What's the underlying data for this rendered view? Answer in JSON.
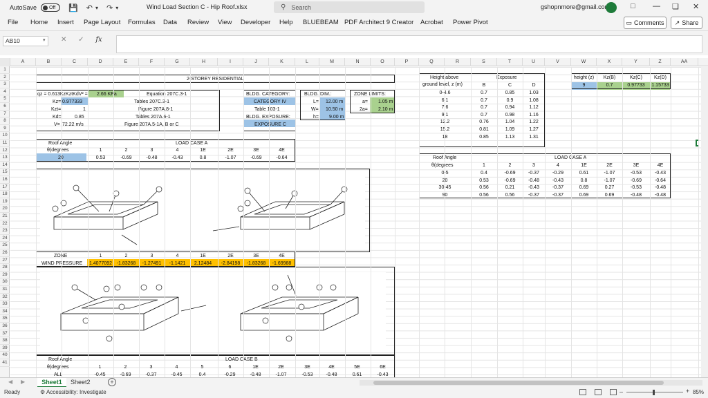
{
  "titlebar": {
    "autosave_label": "AutoSave",
    "autosave_state": "Off",
    "title": "Wind Load Section C - Hip Roof.xlsx",
    "search_placeholder": "Search",
    "user": "gshopnmore@gmail.com"
  },
  "menu": [
    "File",
    "Home",
    "Insert",
    "Page Layout",
    "Formulas",
    "Data",
    "Review",
    "View",
    "Developer",
    "Help",
    "BLUEBEAM",
    "PDF Architect 9 Creator",
    "Acrobat",
    "Power Pivot"
  ],
  "buttons": {
    "comments": "Comments",
    "share": "Share"
  },
  "formula_bar": {
    "name_box": "AB10",
    "fx": "fx"
  },
  "columns": [
    "A",
    "B",
    "C",
    "D",
    "E",
    "F",
    "G",
    "H",
    "I",
    "J",
    "K",
    "L",
    "M",
    "N",
    "O",
    "P",
    "Q",
    "R",
    "S",
    "T",
    "U",
    "V",
    "W",
    "X",
    "Y",
    "Z",
    "AA"
  ],
  "rows": [
    "1",
    "2",
    "3",
    "4",
    "5",
    "6",
    "7",
    "8",
    "9",
    "10",
    "11",
    "12",
    "13",
    "14",
    "15",
    "16",
    "17",
    "18",
    "19",
    "20",
    "21",
    "22",
    "23",
    "24",
    "25",
    "26",
    "27",
    "28",
    "29",
    "30",
    "31",
    "32",
    "33",
    "34",
    "35",
    "36",
    "37",
    "38",
    "39",
    "40",
    "41"
  ],
  "main": {
    "title": "2-STOREY RESIDENTIAL",
    "qz_label": "qz = 0.613KzKztKdV² =",
    "qz_value": "2.66 KPa",
    "qz_ref": "Equation 207C.3-1",
    "kz_label": "Kz=",
    "kz_value": "0.977333",
    "kz_ref": "Tables 207C.3-1",
    "kzt_label": "Kzt=",
    "kzt_value": "1",
    "kzt_ref": "Figure 207A.8-1",
    "kd_label": "Kd=",
    "kd_value": "0.85",
    "kd_ref": "Tables 207A.6-1",
    "v_label": "V=",
    "v_value": "72.22 m/s",
    "v_ref": "Figure 207A.5-1A, B or C",
    "bldg_category_label": "BLDG. CATEGORY:",
    "bldg_category_value": "CATEGORY IV",
    "table_ref": "Table 103-1",
    "bldg_exposure_label": "BLDG. EXPOSURE:",
    "bldg_exposure_value": "EXPOSURE C",
    "bldg_dim_label": "BLDG. DIM.:",
    "L_label": "L=",
    "L_value": "12.00 m",
    "W_label": "W=",
    "W_value": "10.50 m",
    "h_label": "h=",
    "h_value": "9.00 m",
    "zone_limits_label": "ZONE LIMITS:",
    "a_label": "a=",
    "a_value": "1.05 m",
    "a2_label": "2a=",
    "a2_value": "2.10 m"
  },
  "load_case_a_main": {
    "roof_angle_label": "Roof Angle",
    "theta_label": "θ(degrees",
    "title": "LOAD CASE A",
    "headers": [
      "1",
      "2",
      "3",
      "4",
      "1E",
      "2E",
      "3E",
      "4E"
    ],
    "angle": "20",
    "values": [
      "0.53",
      "-0.69",
      "-0.48",
      "-0.43",
      "0.8",
      "-1.07",
      "-0.69",
      "-0.64"
    ]
  },
  "wind_pressure": {
    "zone_label": "ZONE",
    "label": "WIND PRESSURE",
    "headers": [
      "1",
      "2",
      "3",
      "4",
      "1E",
      "2E",
      "3E",
      "4E"
    ],
    "values": [
      "1.4077092",
      "-1.83268",
      "-1.27491",
      "-1.1421",
      "2.12484",
      "-2.84198",
      "-1.83268",
      "-1.69988"
    ]
  },
  "load_case_b": {
    "roof_angle_label": "Roof Angle",
    "theta_label": "θ(degrees",
    "title": "LOAD CASE B",
    "headers": [
      "1",
      "2",
      "3",
      "4",
      "5",
      "6",
      "1E",
      "2E",
      "3E",
      "4E",
      "5E",
      "6E"
    ],
    "angle": "ALL",
    "values": [
      "-0.45",
      "-0.69",
      "-0.37",
      "-0.45",
      "0.4",
      "-0.29",
      "-0.48",
      "-1.07",
      "-0.53",
      "-0.48",
      "0.61",
      "-0.43"
    ]
  },
  "exposure_table": {
    "h1": "Height above",
    "h2": "ground level, z (m)",
    "exposure_label": "Exposure",
    "cols": [
      "B",
      "C",
      "D"
    ],
    "rows": [
      [
        "0-4.6",
        "0.7",
        "0.85",
        "1.03"
      ],
      [
        "6.1",
        "0.7",
        "0.9",
        "1.08"
      ],
      [
        "7.6",
        "0.7",
        "0.94",
        "1.12"
      ],
      [
        "9.1",
        "0.7",
        "0.98",
        "1.16"
      ],
      [
        "12.2",
        "0.76",
        "1.04",
        "1.22"
      ],
      [
        "15.2",
        "0.81",
        "1.09",
        "1.27"
      ],
      [
        "18",
        "0.85",
        "1.13",
        "1.31"
      ]
    ]
  },
  "kz_table": {
    "headers": [
      "height (z)",
      "Kz(B)",
      "Kz(C)",
      "Kz(D)"
    ],
    "values": [
      "9",
      "0.7",
      "0.97733",
      "1.15733"
    ]
  },
  "load_case_a_ref": {
    "roof_angle_label": "Roof Angle",
    "theta_label": "θ(degrees",
    "title": "LOAD CASE A",
    "headers": [
      "1",
      "2",
      "3",
      "4",
      "1E",
      "2E",
      "3E",
      "4E"
    ],
    "rows": [
      [
        "0-5",
        "0.4",
        "-0.69",
        "-0.37",
        "-0.29",
        "0.61",
        "-1.07",
        "-0.53",
        "-0.43"
      ],
      [
        "20",
        "0.53",
        "-0.69",
        "-0.48",
        "-0.43",
        "0.8",
        "-1.07",
        "-0.69",
        "-0.64"
      ],
      [
        "30-45",
        "0.56",
        "0.21",
        "-0.43",
        "-0.37",
        "0.69",
        "0.27",
        "-0.53",
        "-0.48"
      ],
      [
        "90",
        "0.56",
        "0.56",
        "-0.37",
        "-0.37",
        "0.69",
        "0.69",
        "-0.48",
        "-0.48"
      ]
    ]
  },
  "sheets": [
    "Sheet1",
    "Sheet2"
  ],
  "status": {
    "ready": "Ready",
    "accessibility": "Accessibility: Investigate",
    "zoom": "85%"
  }
}
